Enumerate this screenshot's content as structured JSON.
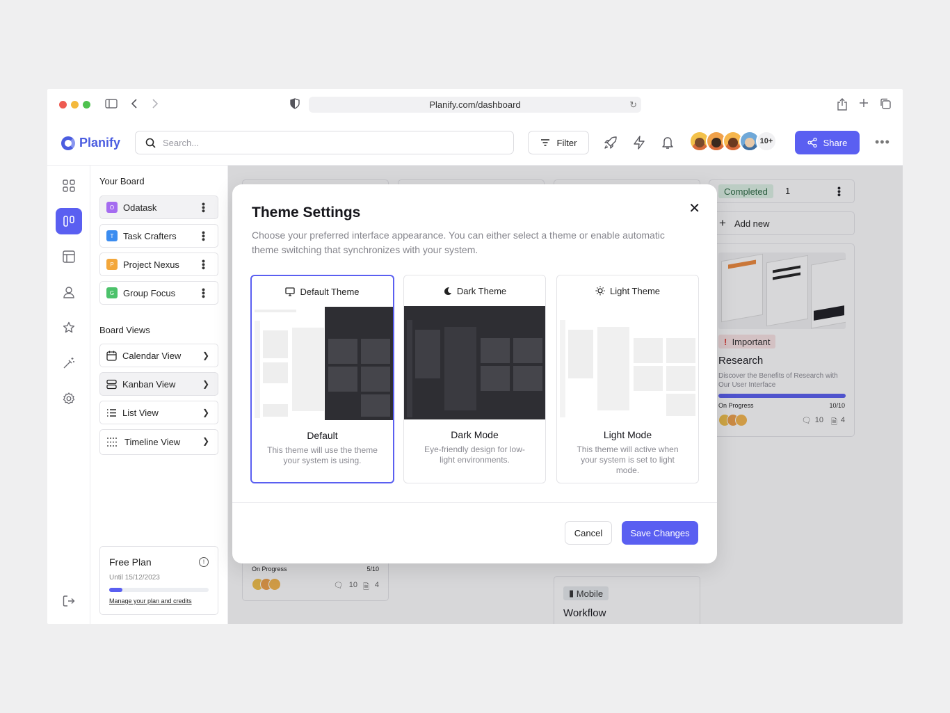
{
  "browser": {
    "url": "Planify.com/dashboard"
  },
  "brand": {
    "name": "Planify",
    "accent": "#5a5ff1"
  },
  "header": {
    "search_placeholder": "Search...",
    "filter_label": "Filter",
    "avatars_more": "10+",
    "share_label": "Share"
  },
  "sidebar": {
    "your_board_title": "Your Board",
    "boards": [
      {
        "label": "Odatask",
        "initial": "O",
        "color": "#a56cf0"
      },
      {
        "label": "Task Crafters",
        "initial": "T",
        "color": "#3b8cf0"
      },
      {
        "label": "Project Nexus",
        "initial": "P",
        "color": "#f3a73b"
      },
      {
        "label": "Group Focus",
        "initial": "G",
        "color": "#4cc26b"
      }
    ],
    "views_title": "Board Views",
    "views": [
      {
        "label": "Calendar View"
      },
      {
        "label": "Kanban View"
      },
      {
        "label": "List View"
      },
      {
        "label": "Timeline  View"
      }
    ],
    "plan": {
      "title": "Free Plan",
      "until": "Until 15/12/2023",
      "progress": 0.13,
      "link": "Manage your plan and credits",
      "info": "!"
    }
  },
  "modal": {
    "title": "Theme Settings",
    "description": "Choose your preferred interface appearance. You can either select a theme or enable automatic theme switching that synchronizes with your system.",
    "themes": [
      {
        "label": "Default Theme",
        "name": "Default",
        "desc": "This theme will use the theme your system is using.",
        "selected": true
      },
      {
        "label": "Dark Theme",
        "name": "Dark Mode",
        "desc": "Eye-friendly design for low-light environments.",
        "selected": false
      },
      {
        "label": "Light Theme",
        "name": "Light Mode",
        "desc": "This theme will active when your system is set to light mode.",
        "selected": false
      }
    ],
    "close": "✕",
    "cancel_label": "Cancel",
    "save_label": "Save Changes"
  },
  "board": {
    "completed_label": "Completed",
    "completed_count": "1",
    "add_new": "Add new",
    "card": {
      "tag": "Important",
      "title": "Research",
      "desc": "Discover the Benefits of Research with Our User Interface",
      "status": "On Progress",
      "progress_text": "10/10",
      "progress": 1.0,
      "comments": "10",
      "files": "4"
    },
    "bottom_card": {
      "status": "On Progress",
      "progress_text": "5/10",
      "comments": "10",
      "files": "4"
    },
    "mobile_card": {
      "tag": "Mobile",
      "title": "Workflow"
    }
  }
}
